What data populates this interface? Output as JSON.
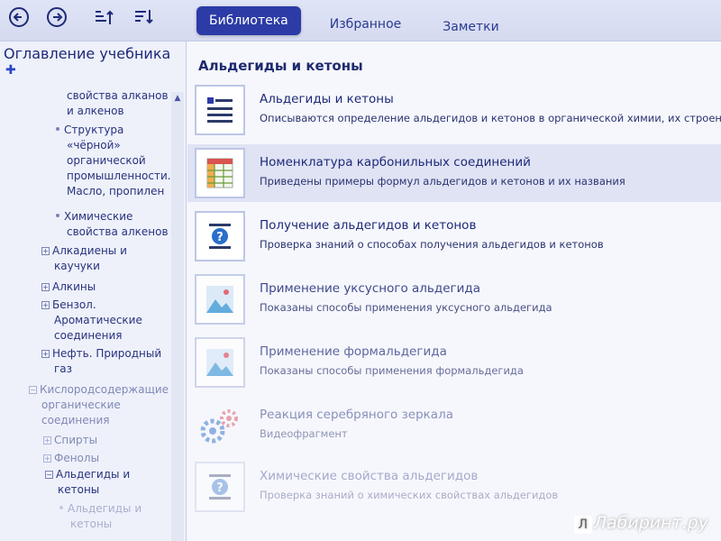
{
  "topbar": {
    "tabs": [
      {
        "label": "Библиотека",
        "active": true
      },
      {
        "label": "Избранное",
        "active": false
      },
      {
        "label": "Заметки",
        "active": false
      }
    ]
  },
  "sidebar": {
    "title": "Оглавление учебника",
    "items": [
      "свойства алканов",
      "и алкенов",
      "Структура",
      "«чёрной»",
      "органической",
      "промышленности.",
      "Масло, пропилен",
      "Химические",
      "свойства алкенов",
      "Алкадиены и",
      "каучуки",
      "Алкины",
      "Бензол.",
      "Ароматические",
      "соединения",
      "Нефть. Природный",
      "газ",
      "Кислородсодержащие",
      "органические",
      "соединения",
      "Спирты",
      "Фенолы",
      "Альдегиды и",
      "кетоны",
      "Альдегиды и",
      "кетоны"
    ]
  },
  "main": {
    "title": "Альдегиды и кетоны",
    "items": [
      {
        "title": "Альдегиды и кетоны",
        "desc": "Описываются определение альдегидов и кетонов в органической химии, их строение и",
        "icon": "document-list-icon"
      },
      {
        "title": "Номенклатура карбонильных соединений",
        "desc": "Приведены примеры формул альдегидов и кетонов и их названия",
        "icon": "table-icon"
      },
      {
        "title": "Получение альдегидов и кетонов",
        "desc": "Проверка знаний о способах получения альдегидов и кетонов",
        "icon": "quiz-icon"
      },
      {
        "title": "Применение уксусного альдегида",
        "desc": "Показаны способы применения уксусного альдегида",
        "icon": "image-icon"
      },
      {
        "title": "Применение формальдегида",
        "desc": "Показаны способы применения формальдегида",
        "icon": "image-icon"
      },
      {
        "title": "Реакция серебряного зеркала",
        "desc": "Видеофрагмент",
        "icon": "video-gears-icon"
      },
      {
        "title": "Химические свойства альдегидов",
        "desc": "Проверка знаний о химических свойствах альдегидов",
        "icon": "quiz-icon"
      }
    ]
  },
  "watermark": {
    "brand": "Лабиринт.ру",
    "letter": "Л"
  },
  "colors": {
    "accent": "#2c3ba6",
    "text": "#1e2a6e"
  }
}
